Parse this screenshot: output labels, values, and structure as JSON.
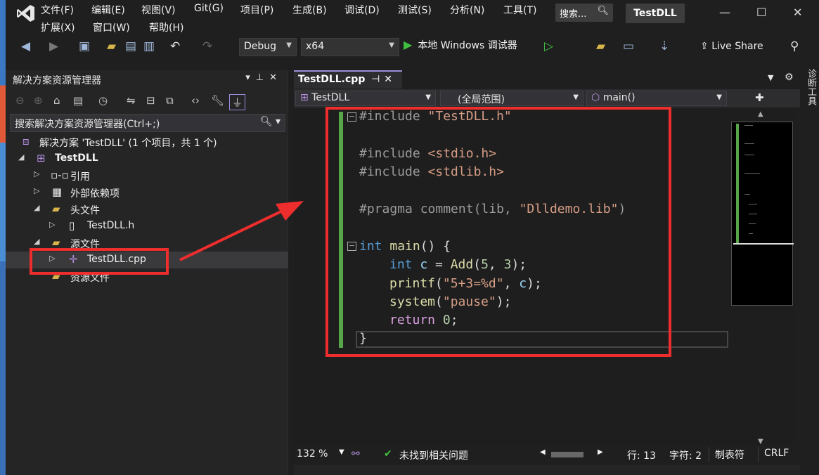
{
  "window": {
    "menus_row1": [
      "文件(F)",
      "编辑(E)",
      "视图(V)",
      "Git(G)",
      "项目(P)",
      "生成(B)",
      "调试(D)",
      "测试(S)",
      "分析(N)",
      "工具(T)"
    ],
    "menus_row2": [
      "扩展(X)",
      "窗口(W)",
      "帮助(H)"
    ],
    "search_label": "搜索...",
    "solution_name": "TestDLL",
    "minimize": "—",
    "maximize": "☐",
    "close": "✕"
  },
  "toolbar": {
    "config": "Debug",
    "platform": "x64",
    "run_label": "本地 Windows 调试器",
    "live_share": "Live Share"
  },
  "solution_explorer": {
    "title": "解决方案资源管理器",
    "search_placeholder": "搜索解决方案资源管理器(Ctrl+;)",
    "tree": {
      "solution": "解决方案 'TestDLL' (1 个项目，共 1 个)",
      "project": "TestDLL",
      "references": "引用",
      "external_deps": "外部依赖项",
      "header_files": "头文件",
      "header_file": "TestDLL.h",
      "source_files": "源文件",
      "source_file": "TestDLL.cpp",
      "resource_files": "资源文件"
    }
  },
  "editor": {
    "tab_label": "TestDLL.cpp",
    "nav_project": "TestDLL",
    "nav_scope": "(全局范围)",
    "nav_member": "main()",
    "code": {
      "l1_directive": "#include",
      "l1_path": "\"TestDLL.h\"",
      "l3_directive": "#include",
      "l3_path": "<stdio.h>",
      "l4_directive": "#include",
      "l4_path": "<stdlib.h>",
      "l6_pragma": "#pragma comment",
      "l6_open": "(lib, ",
      "l6_str": "\"Dlldemo.lib\"",
      "l6_close": ")",
      "l8_type": "int",
      "l8_name": "main",
      "l8_rest": "() {",
      "l9_type": "int",
      "l9_var": "c",
      "l9_eq": " = ",
      "l9_fn": "Add",
      "l9_args_open": "(",
      "l9_n1": "5",
      "l9_comma": ", ",
      "l9_n2": "3",
      "l9_end": ");",
      "l10_fn": "printf",
      "l10_open": "(",
      "l10_str": "\"5+3=%d\"",
      "l10_mid": ", ",
      "l10_var": "c",
      "l10_end": ");",
      "l11_fn": "system",
      "l11_open": "(",
      "l11_str": "\"pause\"",
      "l11_end": ");",
      "l12_kw": "return",
      "l12_num": "0",
      "l12_end": ";",
      "l13": "}"
    }
  },
  "status": {
    "zoom": "132 %",
    "issues": "未找到相关问题",
    "line": "行: 13",
    "col": "字符: 2",
    "indent": "制表符",
    "eol": "CRLF"
  },
  "right_rail": {
    "diagnostics": "诊断工具"
  },
  "colors": {
    "accent_purple": "#9a8cdb",
    "annotation_red": "#ee2d2d",
    "change_bar_green": "#57a64a"
  }
}
